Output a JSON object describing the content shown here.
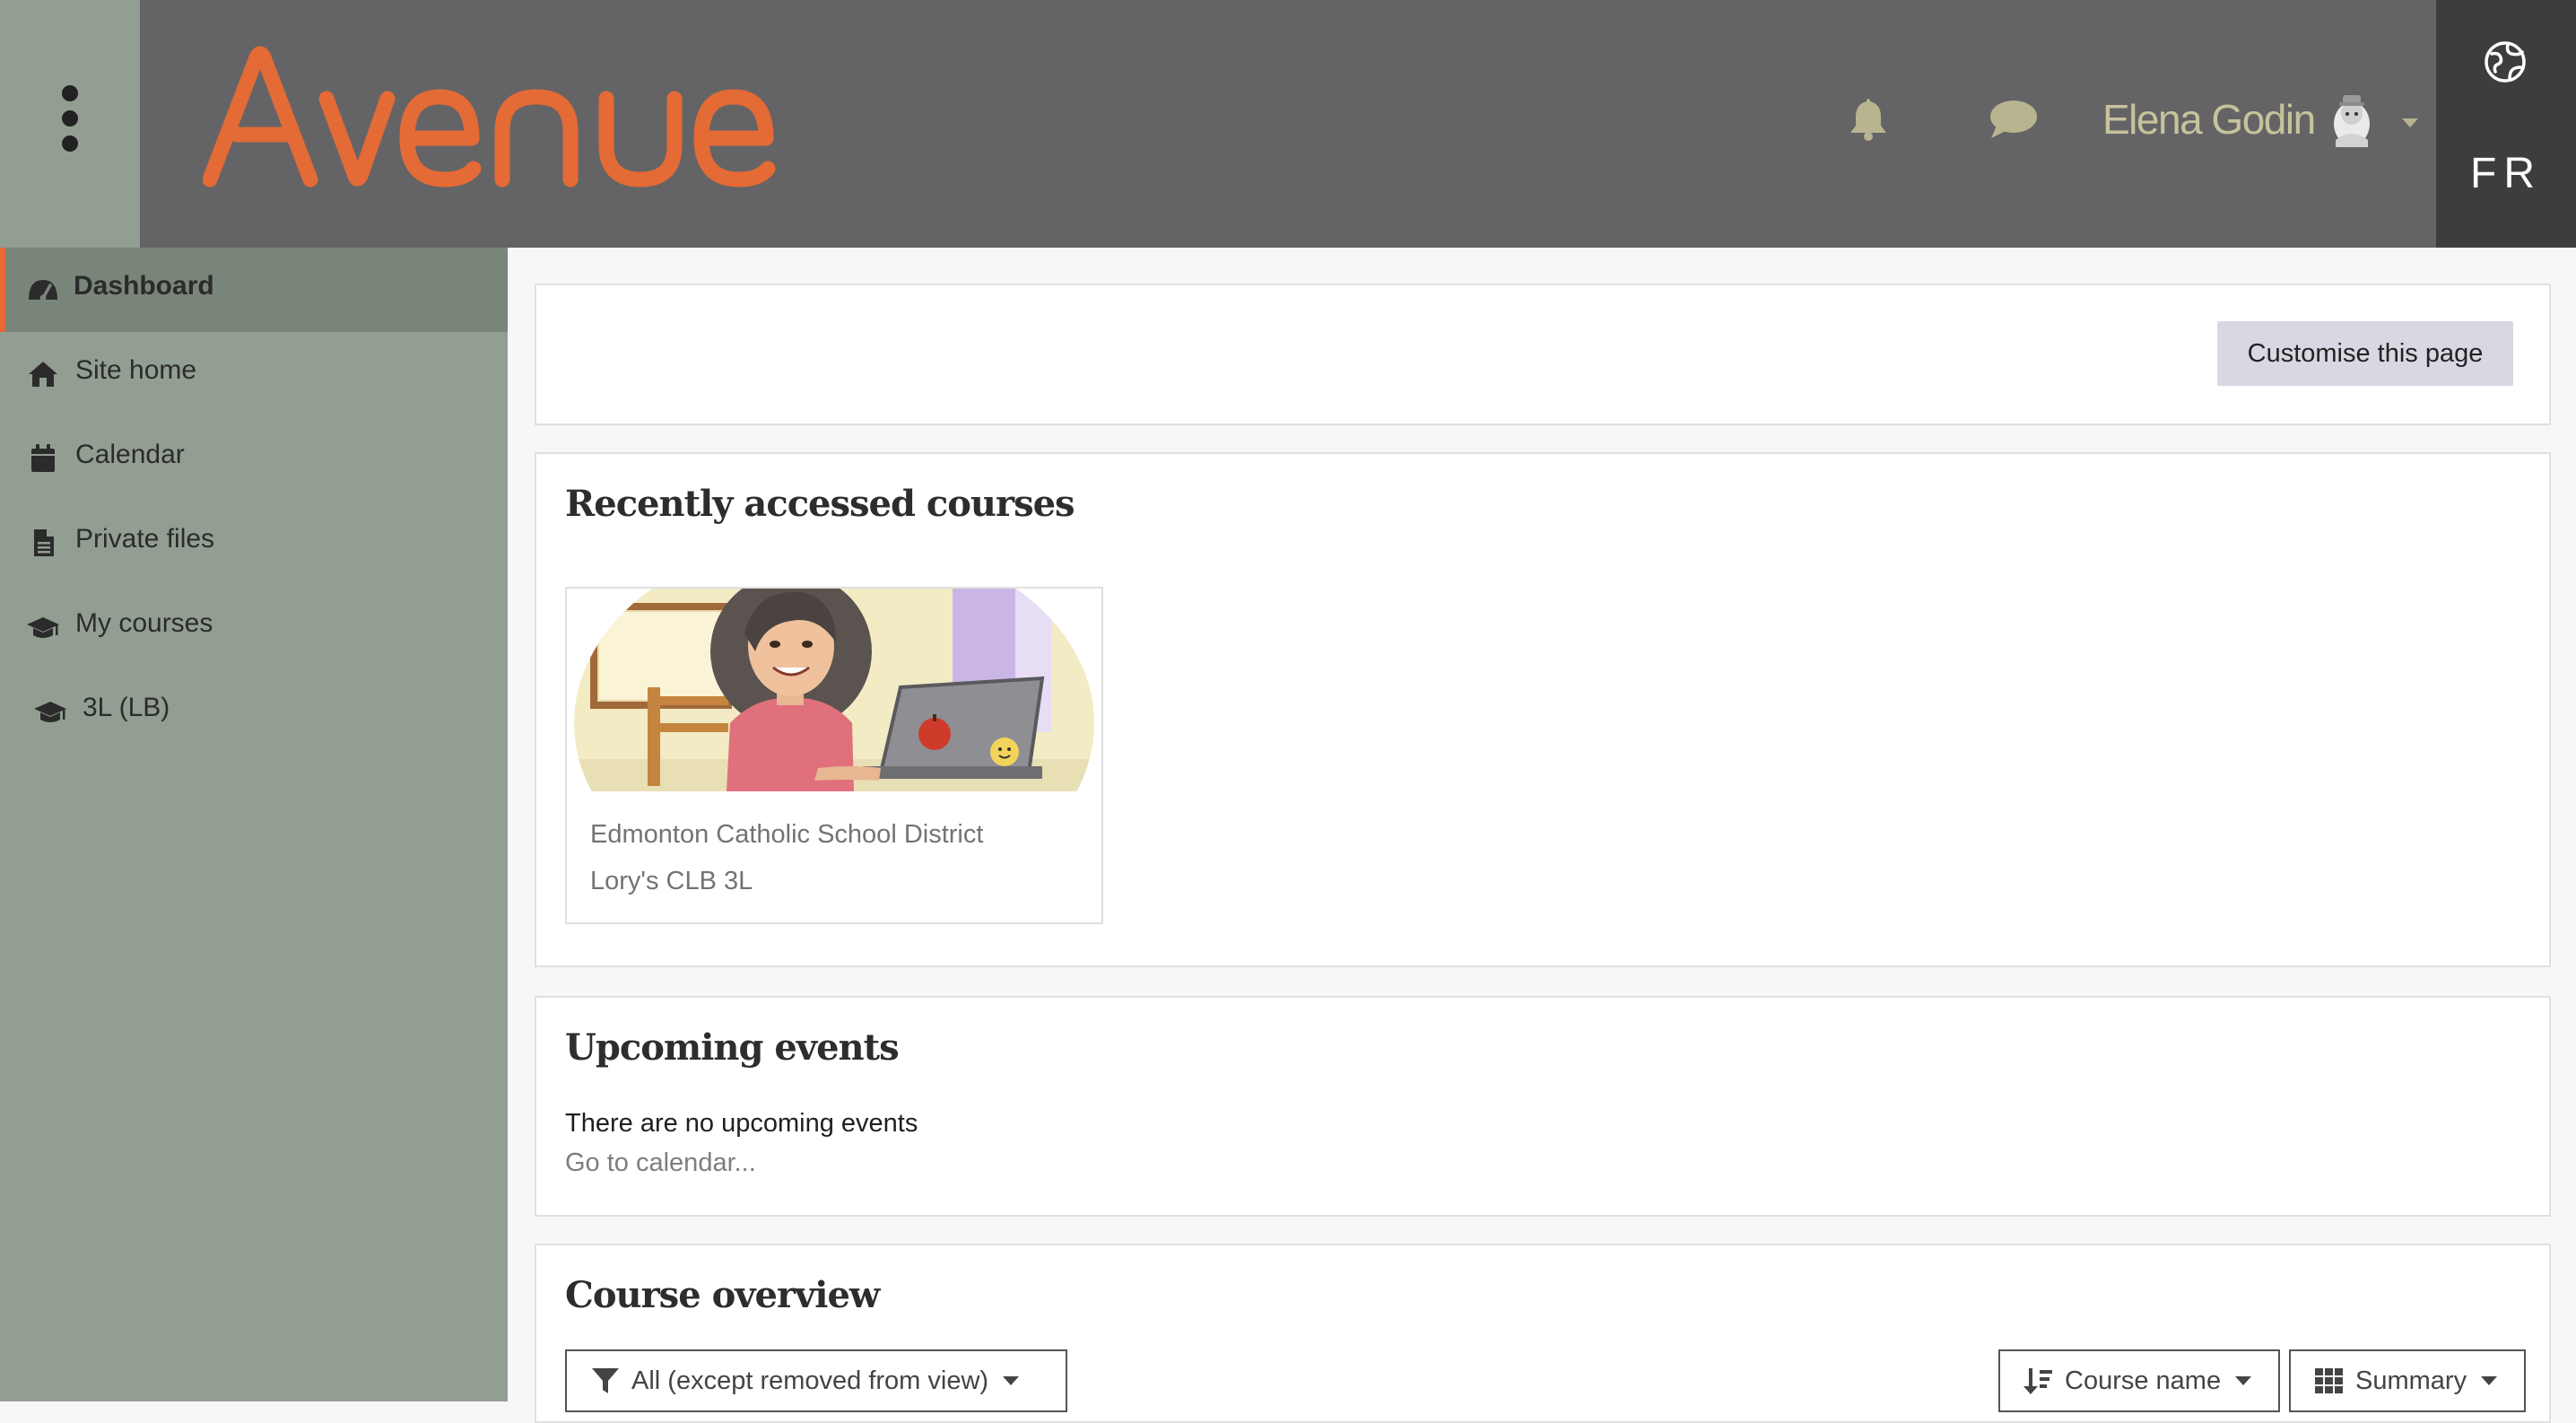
{
  "header": {
    "logo_text": "Avenue",
    "user_name": "Elena Godin",
    "language": "FR"
  },
  "sidebar": {
    "items": [
      {
        "label": "Dashboard",
        "icon": "dashboard-icon",
        "active": true
      },
      {
        "label": "Site home",
        "icon": "home-icon"
      },
      {
        "label": "Calendar",
        "icon": "calendar-icon"
      },
      {
        "label": "Private files",
        "icon": "file-icon"
      },
      {
        "label": "My courses",
        "icon": "graduation-cap-icon"
      },
      {
        "label": "3L (LB)",
        "icon": "graduation-cap-icon"
      }
    ]
  },
  "main": {
    "customise_label": "Customise this page",
    "recent": {
      "title": "Recently accessed courses",
      "course": {
        "category": "Edmonton Catholic School District",
        "name": "Lory's CLB 3L"
      }
    },
    "upcoming": {
      "title": "Upcoming events",
      "empty_text": "There are no upcoming events",
      "calendar_link": "Go to calendar..."
    },
    "overview": {
      "title": "Course overview",
      "filter_label": "All (except removed from view)",
      "sort_label": "Course name",
      "view_label": "Summary"
    }
  },
  "colors": {
    "brand_orange": "#e46a36",
    "header_bg": "#646466",
    "sidebar_bg": "#929e92",
    "user_name": "#c6c39b"
  }
}
